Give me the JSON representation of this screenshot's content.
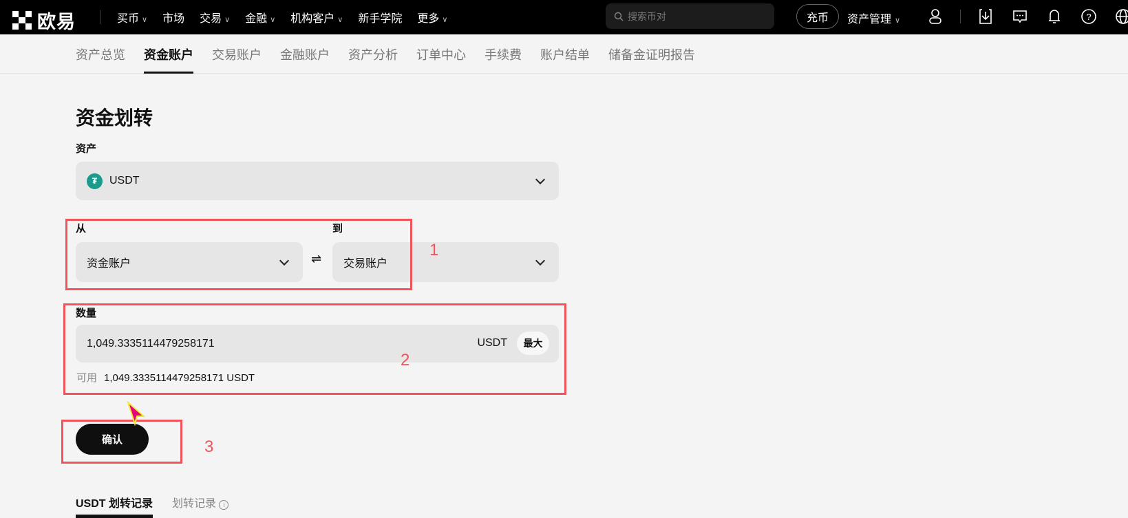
{
  "header": {
    "logo_text": "欧易",
    "nav": [
      {
        "label": "买币",
        "dropdown": true
      },
      {
        "label": "市场",
        "dropdown": false
      },
      {
        "label": "交易",
        "dropdown": true
      },
      {
        "label": "金融",
        "dropdown": true
      },
      {
        "label": "机构客户",
        "dropdown": true
      },
      {
        "label": "新手学院",
        "dropdown": false
      },
      {
        "label": "更多",
        "dropdown": true
      }
    ],
    "search_placeholder": "搜索币对",
    "deposit": "充币",
    "asset_management": "资产管理"
  },
  "subnav": {
    "tabs": [
      "资产总览",
      "资金账户",
      "交易账户",
      "金融账户",
      "资产分析",
      "订单中心",
      "手续费",
      "账户结单",
      "储备金证明报告"
    ],
    "active": 1
  },
  "form": {
    "title": "资金划转",
    "asset_label": "资产",
    "asset": "USDT",
    "from_label": "从",
    "from": "资金账户",
    "to_label": "到",
    "to": "交易账户",
    "amount_label": "数量",
    "amount": "1,049.3335114479258171",
    "unit": "USDT",
    "max": "最大",
    "available_label": "可用",
    "available": "1,049.3335114479258171 USDT",
    "confirm": "确认"
  },
  "annotations": [
    "1",
    "2",
    "3"
  ],
  "history_tabs": [
    "USDT 划转记录",
    "划转记录"
  ],
  "colors": {
    "annotation": "#f0545a",
    "coin": "#1a9b8c"
  }
}
